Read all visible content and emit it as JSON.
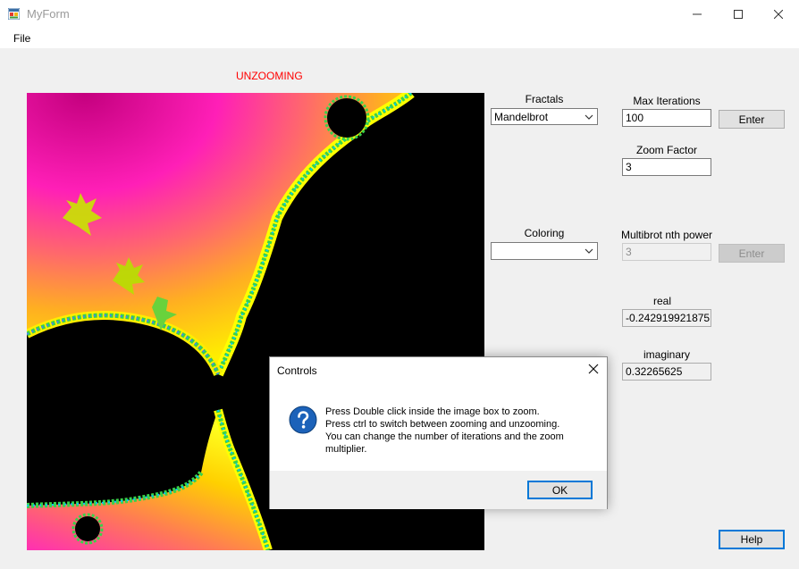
{
  "window": {
    "title": "MyForm",
    "minimize_icon": "minimize-icon",
    "maximize_icon": "maximize-icon",
    "close_icon": "close-icon"
  },
  "menu": {
    "file": "File"
  },
  "status": {
    "mode": "UNZOOMING",
    "color": "#ff0000"
  },
  "fractals": {
    "label": "Fractals",
    "selected": "Mandelbrot"
  },
  "coloring": {
    "label": "Coloring",
    "selected": ""
  },
  "max_iterations": {
    "label": "Max Iterations",
    "value": "100",
    "enter": "Enter"
  },
  "zoom_factor": {
    "label": "Zoom Factor",
    "value": "3"
  },
  "multibrot": {
    "label": "Multibrot nth power",
    "value": "3",
    "enter": "Enter"
  },
  "real": {
    "label": "real",
    "value": "-0.242919921875"
  },
  "imaginary": {
    "label": "imaginary",
    "value": "0.32265625"
  },
  "help": {
    "label": "Help"
  },
  "dialog": {
    "title": "Controls",
    "icon": "question-icon",
    "lines": [
      "Press Double click inside the image box to zoom.",
      "Press ctrl to switch between zooming and unzooming.",
      "You can change the number of iterations and the zoom",
      "multiplier."
    ],
    "ok": "OK"
  }
}
